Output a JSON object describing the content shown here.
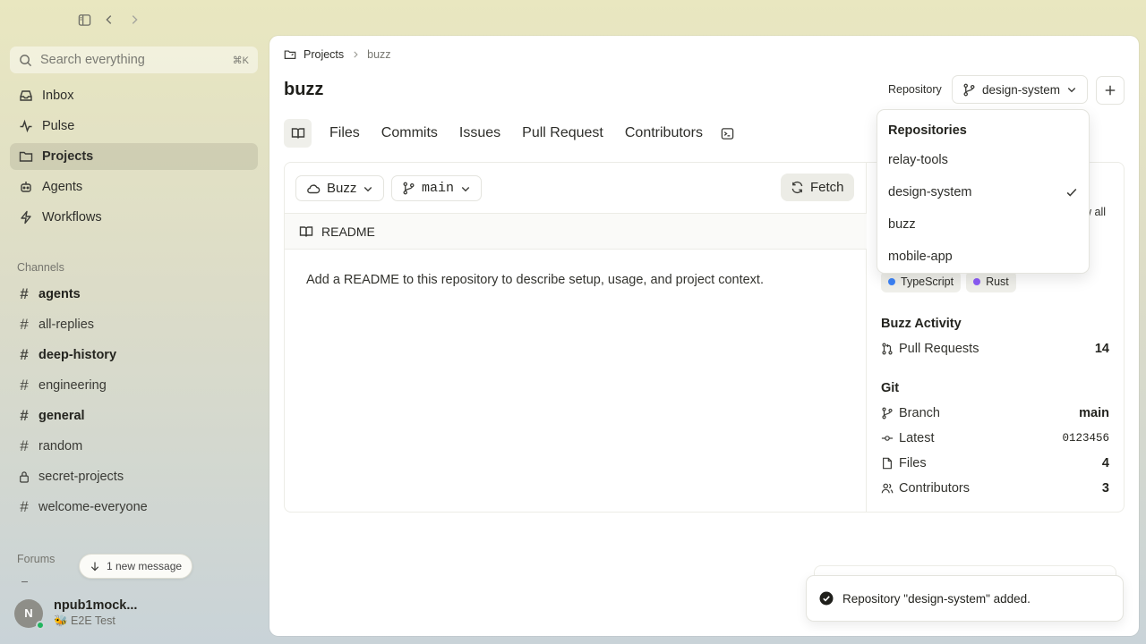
{
  "sidebar": {
    "search": {
      "placeholder": "Search everything",
      "shortcut": "⌘K"
    },
    "nav": [
      {
        "label": "Inbox",
        "icon": "inbox-icon"
      },
      {
        "label": "Pulse",
        "icon": "pulse-icon"
      },
      {
        "label": "Projects",
        "icon": "folder-icon",
        "active": true
      },
      {
        "label": "Agents",
        "icon": "agents-icon"
      },
      {
        "label": "Workflows",
        "icon": "bolt-icon"
      }
    ],
    "channels_label": "Channels",
    "channels": [
      {
        "name": "agents",
        "bold": true
      },
      {
        "name": "all-replies",
        "bold": false
      },
      {
        "name": "deep-history",
        "bold": true
      },
      {
        "name": "engineering",
        "bold": false
      },
      {
        "name": "general",
        "bold": true
      },
      {
        "name": "random",
        "bold": false
      },
      {
        "name": "secret-projects",
        "bold": false,
        "locked": true
      },
      {
        "name": "welcome-everyone",
        "bold": false
      }
    ],
    "forums_label": "Forums",
    "new_message": "1 new message",
    "user": {
      "initial": "N",
      "name": "npub1mock...",
      "status": "🐝 E2E Test"
    }
  },
  "main": {
    "breadcrumb": {
      "root": "Projects",
      "current": "buzz"
    },
    "title": "buzz",
    "repository_label": "Repository",
    "repository_selected": "design-system",
    "tabs": [
      "Files",
      "Commits",
      "Issues",
      "Pull Request",
      "Contributors"
    ],
    "remote_label": "Buzz",
    "branch_label": "main",
    "fetch_label": "Fetch",
    "readme_title": "README",
    "readme_body": "Add a README to this repository to describe setup, usage, and project context.",
    "view_all_partial": "w all",
    "languages": [
      {
        "name": "TypeScript",
        "color": "#3b82f6"
      },
      {
        "name": "Rust",
        "color": "#8b5cf6"
      }
    ],
    "activity": {
      "title": "Buzz Activity",
      "rows": [
        {
          "label": "Pull Requests",
          "value": "14"
        }
      ]
    },
    "git": {
      "title": "Git",
      "branch": {
        "label": "Branch",
        "value": "main"
      },
      "latest": {
        "label": "Latest",
        "value": "0123456"
      },
      "files": {
        "label": "Files",
        "value": "4"
      },
      "contributors": {
        "label": "Contributors",
        "value": "3"
      }
    }
  },
  "dropdown": {
    "title": "Repositories",
    "items": [
      {
        "name": "relay-tools",
        "checked": false
      },
      {
        "name": "design-system",
        "checked": true
      },
      {
        "name": "buzz",
        "checked": false
      },
      {
        "name": "mobile-app",
        "checked": false
      }
    ]
  },
  "toast": {
    "message": "Repository \"design-system\" added."
  }
}
